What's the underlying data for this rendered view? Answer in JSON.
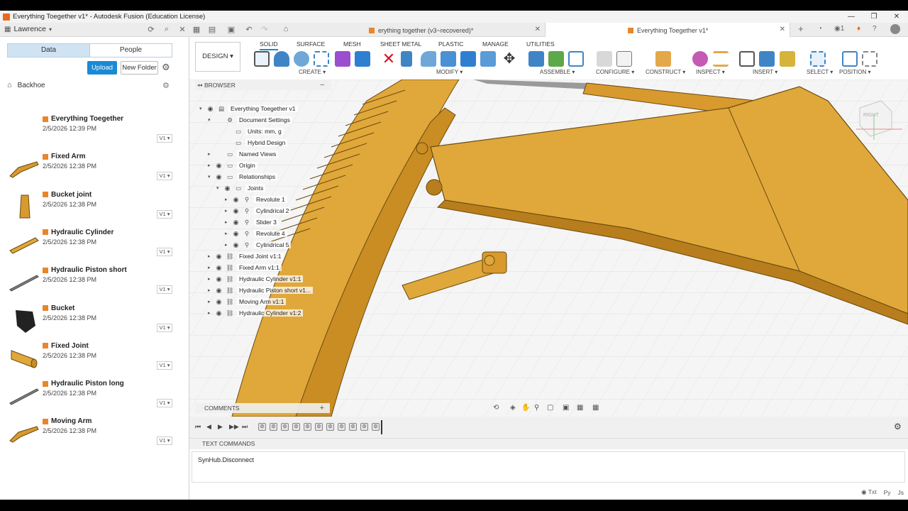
{
  "window": {
    "title": "Everything Toegether v1* - Autodesk Fusion (Education License)",
    "controls": [
      "—",
      "❐",
      "✕"
    ]
  },
  "tabbar": {
    "user": "Lawrence",
    "tabs": [
      {
        "label": "erything together (v3~recovered)*",
        "active": false
      },
      {
        "label": "Everything Toegether v1*",
        "active": true
      }
    ],
    "right_count": "1"
  },
  "datapanel": {
    "seg_data": "Data",
    "seg_people": "People",
    "upload_label": "Upload",
    "new_folder_label": "New Folder",
    "breadcrumb": "Backhoe",
    "files": [
      {
        "name": "Everything Toegether",
        "date": "2/5/2026 12:39 PM",
        "version": "V1 ▾",
        "thumb": "blank"
      },
      {
        "name": "Fixed Arm",
        "date": "2/5/2026 12:38 PM",
        "version": "V1 ▾",
        "thumb": "arm"
      },
      {
        "name": "Bucket joint",
        "date": "2/5/2026 12:38 PM",
        "version": "V1 ▾",
        "thumb": "joint"
      },
      {
        "name": "Hydraulic Cylinder",
        "date": "2/5/2026 12:38 PM",
        "version": "V1 ▾",
        "thumb": "cyl"
      },
      {
        "name": "Hydraulic Piston short",
        "date": "2/5/2026 12:38 PM",
        "version": "V1 ▾",
        "thumb": "rod"
      },
      {
        "name": "Bucket",
        "date": "2/5/2026 12:38 PM",
        "version": "V1 ▾",
        "thumb": "bucket"
      },
      {
        "name": "Fixed Joint",
        "date": "2/5/2026 12:38 PM",
        "version": "V1 ▾",
        "thumb": "pin"
      },
      {
        "name": "Hydraulic Piston long",
        "date": "2/5/2026 12:38 PM",
        "version": "V1 ▾",
        "thumb": "rod"
      },
      {
        "name": "Moving Arm",
        "date": "2/5/2026 12:38 PM",
        "version": "V1 ▾",
        "thumb": "arm"
      }
    ]
  },
  "toolbar": {
    "design_label": "DESIGN ▾",
    "tabs": [
      "SOLID",
      "SURFACE",
      "MESH",
      "SHEET METAL",
      "PLASTIC",
      "MANAGE",
      "UTILITIES"
    ],
    "active_tab": "SOLID",
    "groups": [
      "CREATE ▾",
      "MODIFY ▾",
      "ASSEMBLE ▾",
      "CONFIGURE ▾",
      "CONSTRUCT ▾",
      "INSPECT ▾",
      "INSERT ▾",
      "SELECT ▾",
      "POSITION ▾"
    ]
  },
  "browser": {
    "header": "BROWSER",
    "rows": [
      {
        "label": "Everything Toegether v1",
        "depth": 0,
        "arrow": "▾",
        "icon": "component"
      },
      {
        "label": "Document Settings",
        "depth": 1,
        "arrow": "▾",
        "icon": "gear"
      },
      {
        "label": "Units: mm, g",
        "depth": 2,
        "arrow": "",
        "icon": "doc"
      },
      {
        "label": "Hybrid Design",
        "depth": 2,
        "arrow": "",
        "icon": "doc"
      },
      {
        "label": "Named Views",
        "depth": 1,
        "arrow": "▸",
        "icon": "folder"
      },
      {
        "label": "Origin",
        "depth": 1,
        "arrow": "▸",
        "icon": "folder"
      },
      {
        "label": "Relationships",
        "depth": 1,
        "arrow": "▾",
        "icon": "folder"
      },
      {
        "label": "Joints",
        "depth": 2,
        "arrow": "▾",
        "icon": "folder"
      },
      {
        "label": "Revolute 1",
        "depth": 3,
        "arrow": "▸",
        "icon": "joint"
      },
      {
        "label": "Cylindrical 2",
        "depth": 3,
        "arrow": "▸",
        "icon": "joint"
      },
      {
        "label": "Slider 3",
        "depth": 3,
        "arrow": "▸",
        "icon": "joint"
      },
      {
        "label": "Revolute 4",
        "depth": 3,
        "arrow": "▸",
        "icon": "joint"
      },
      {
        "label": "Cylindrical 5",
        "depth": 3,
        "arrow": "▸",
        "icon": "joint"
      },
      {
        "label": "Fixed Joint v1:1",
        "depth": 1,
        "arrow": "▸",
        "icon": "link"
      },
      {
        "label": "Fixed Arm v1:1",
        "depth": 1,
        "arrow": "▸",
        "icon": "link"
      },
      {
        "label": "Hydraulic Cylinder v1:1",
        "depth": 1,
        "arrow": "▸",
        "icon": "link"
      },
      {
        "label": "Hydraulic Piston short v1...",
        "depth": 1,
        "arrow": "▸",
        "icon": "link"
      },
      {
        "label": "Moving Arm v1:1",
        "depth": 1,
        "arrow": "▸",
        "icon": "link"
      },
      {
        "label": "Hydraulic Cylinder v1:2",
        "depth": 1,
        "arrow": "▸",
        "icon": "link"
      }
    ]
  },
  "viewcube": {
    "label": "RIGHT"
  },
  "comments": {
    "header": "COMMENTS"
  },
  "textcommands": {
    "header": "TEXT COMMANDS",
    "line": "SynHub.Disconnect",
    "modes": [
      "Txt",
      "Py",
      "Js"
    ]
  },
  "colors": {
    "accent": "#1a8ad4",
    "model": "#e0a83a",
    "fusion_orange": "#e8862c"
  }
}
